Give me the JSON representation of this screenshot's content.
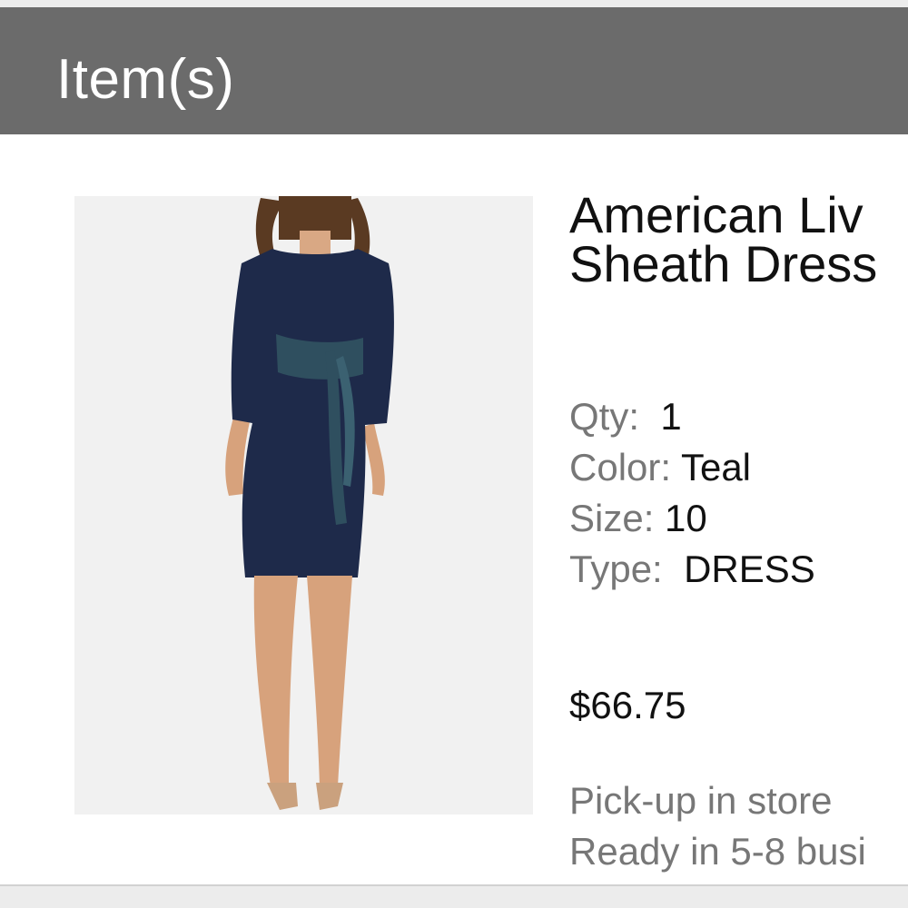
{
  "header": {
    "title": "Item(s)"
  },
  "item": {
    "image_alt": "Woman wearing navy sheath dress with teal tie waist",
    "name_line1": "American Liv",
    "name_line2": "Sheath Dress",
    "qty_label": "Qty:",
    "qty_value": "1",
    "color_label": "Color:",
    "color_value": "Teal",
    "size_label": "Size:",
    "size_value": "10",
    "type_label": "Type:",
    "type_value": "DRESS",
    "price": "$66.75",
    "pickup_line1": "Pick-up in store",
    "pickup_line2": "Ready in 5-8 busi"
  },
  "colors": {
    "header_bg": "#6b6b6b",
    "page_bg": "#ececec",
    "card_bg": "#ffffff",
    "label_gray": "#777777",
    "dress_navy": "#1e2a4a",
    "sash_teal": "#2f4f5f"
  }
}
